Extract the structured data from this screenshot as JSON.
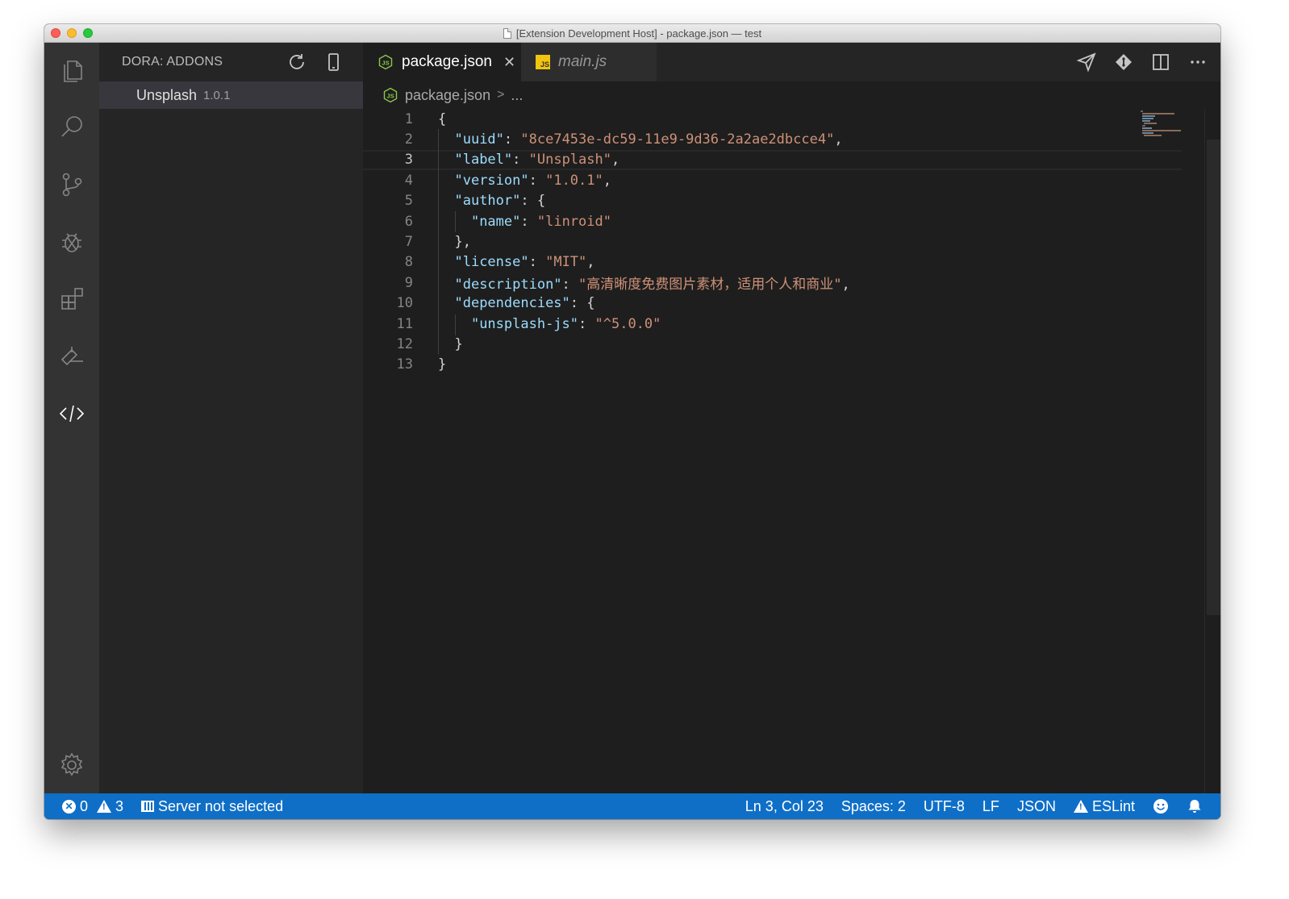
{
  "window": {
    "title": "[Extension Development Host] - package.json — test"
  },
  "activity_bar": {
    "icons": [
      "files-icon",
      "search-icon",
      "source-control-icon",
      "debug-icon",
      "extensions-icon",
      "deploy-icon",
      "code-icon",
      "settings-gear-icon"
    ]
  },
  "sidebar": {
    "title": "DORA: ADDONS",
    "items": [
      {
        "name": "Unsplash",
        "version": "1.0.1"
      }
    ]
  },
  "tabs": [
    {
      "label": "package.json",
      "active": true,
      "icon": "json-file-icon"
    },
    {
      "label": "main.js",
      "active": false,
      "icon": "js-file-icon"
    }
  ],
  "breadcrumb": {
    "file": "package.json",
    "separator": ">",
    "more": "..."
  },
  "editor": {
    "current_line": 3,
    "lines": [
      {
        "num": "1",
        "text": "{"
      },
      {
        "num": "2",
        "key": "\"uuid\"",
        "sep": ": ",
        "val": "\"8ce7453e-dc59-11e9-9d36-2a2ae2dbcce4\"",
        "end": ",",
        "indent": "  "
      },
      {
        "num": "3",
        "key": "\"label\"",
        "sep": ": ",
        "val": "\"Unsplash\"",
        "end": ",",
        "indent": "  "
      },
      {
        "num": "4",
        "key": "\"version\"",
        "sep": ": ",
        "val": "\"1.0.1\"",
        "end": ",",
        "indent": "  "
      },
      {
        "num": "5",
        "key": "\"author\"",
        "sep": ": {",
        "val": "",
        "end": "",
        "indent": "  "
      },
      {
        "num": "6",
        "key": "\"name\"",
        "sep": ": ",
        "val": "\"linroid\"",
        "end": "",
        "indent": "    "
      },
      {
        "num": "7",
        "text": "  },",
        "indent": ""
      },
      {
        "num": "8",
        "key": "\"license\"",
        "sep": ": ",
        "val": "\"MIT\"",
        "end": ",",
        "indent": "  "
      },
      {
        "num": "9",
        "key": "\"description\"",
        "sep": ": ",
        "val": "\"高清晰度免费图片素材，适用个人和商业\"",
        "end": ",",
        "indent": "  "
      },
      {
        "num": "10",
        "key": "\"dependencies\"",
        "sep": ": {",
        "val": "",
        "end": "",
        "indent": "  "
      },
      {
        "num": "11",
        "key": "\"unsplash-js\"",
        "sep": ": ",
        "val": "\"^5.0.0\"",
        "end": "",
        "indent": "    "
      },
      {
        "num": "12",
        "text": "  }",
        "indent": ""
      },
      {
        "num": "13",
        "text": "}"
      }
    ]
  },
  "status_bar": {
    "errors": "0",
    "warnings": "3",
    "server": "Server not selected",
    "position": "Ln 3, Col 23",
    "spaces": "Spaces: 2",
    "encoding": "UTF-8",
    "eol": "LF",
    "language": "JSON",
    "eslint": "ESLint"
  },
  "colors": {
    "status_bar": "#0f6fc7",
    "json_key": "#9cdcfe",
    "json_string": "#ce9178",
    "editor_bg": "#1e1e1e"
  }
}
